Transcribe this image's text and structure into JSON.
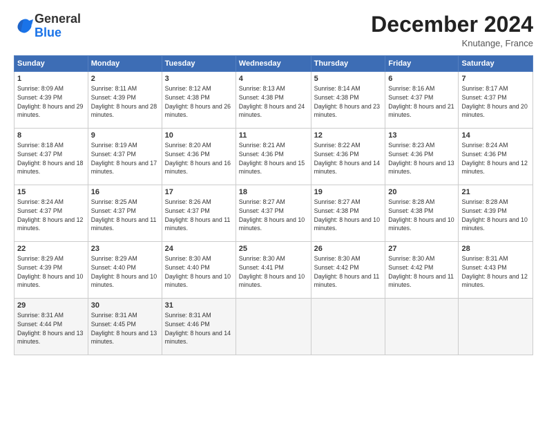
{
  "header": {
    "logo_general": "General",
    "logo_blue": "Blue",
    "title": "December 2024",
    "location": "Knutange, France"
  },
  "days_of_week": [
    "Sunday",
    "Monday",
    "Tuesday",
    "Wednesday",
    "Thursday",
    "Friday",
    "Saturday"
  ],
  "weeks": [
    [
      {
        "day": "1",
        "sunrise": "8:09 AM",
        "sunset": "4:39 PM",
        "daylight": "8 hours and 29 minutes."
      },
      {
        "day": "2",
        "sunrise": "8:11 AM",
        "sunset": "4:39 PM",
        "daylight": "8 hours and 28 minutes."
      },
      {
        "day": "3",
        "sunrise": "8:12 AM",
        "sunset": "4:38 PM",
        "daylight": "8 hours and 26 minutes."
      },
      {
        "day": "4",
        "sunrise": "8:13 AM",
        "sunset": "4:38 PM",
        "daylight": "8 hours and 24 minutes."
      },
      {
        "day": "5",
        "sunrise": "8:14 AM",
        "sunset": "4:38 PM",
        "daylight": "8 hours and 23 minutes."
      },
      {
        "day": "6",
        "sunrise": "8:16 AM",
        "sunset": "4:37 PM",
        "daylight": "8 hours and 21 minutes."
      },
      {
        "day": "7",
        "sunrise": "8:17 AM",
        "sunset": "4:37 PM",
        "daylight": "8 hours and 20 minutes."
      }
    ],
    [
      {
        "day": "8",
        "sunrise": "8:18 AM",
        "sunset": "4:37 PM",
        "daylight": "8 hours and 18 minutes."
      },
      {
        "day": "9",
        "sunrise": "8:19 AM",
        "sunset": "4:37 PM",
        "daylight": "8 hours and 17 minutes."
      },
      {
        "day": "10",
        "sunrise": "8:20 AM",
        "sunset": "4:36 PM",
        "daylight": "8 hours and 16 minutes."
      },
      {
        "day": "11",
        "sunrise": "8:21 AM",
        "sunset": "4:36 PM",
        "daylight": "8 hours and 15 minutes."
      },
      {
        "day": "12",
        "sunrise": "8:22 AM",
        "sunset": "4:36 PM",
        "daylight": "8 hours and 14 minutes."
      },
      {
        "day": "13",
        "sunrise": "8:23 AM",
        "sunset": "4:36 PM",
        "daylight": "8 hours and 13 minutes."
      },
      {
        "day": "14",
        "sunrise": "8:24 AM",
        "sunset": "4:36 PM",
        "daylight": "8 hours and 12 minutes."
      }
    ],
    [
      {
        "day": "15",
        "sunrise": "8:24 AM",
        "sunset": "4:37 PM",
        "daylight": "8 hours and 12 minutes."
      },
      {
        "day": "16",
        "sunrise": "8:25 AM",
        "sunset": "4:37 PM",
        "daylight": "8 hours and 11 minutes."
      },
      {
        "day": "17",
        "sunrise": "8:26 AM",
        "sunset": "4:37 PM",
        "daylight": "8 hours and 11 minutes."
      },
      {
        "day": "18",
        "sunrise": "8:27 AM",
        "sunset": "4:37 PM",
        "daylight": "8 hours and 10 minutes."
      },
      {
        "day": "19",
        "sunrise": "8:27 AM",
        "sunset": "4:38 PM",
        "daylight": "8 hours and 10 minutes."
      },
      {
        "day": "20",
        "sunrise": "8:28 AM",
        "sunset": "4:38 PM",
        "daylight": "8 hours and 10 minutes."
      },
      {
        "day": "21",
        "sunrise": "8:28 AM",
        "sunset": "4:39 PM",
        "daylight": "8 hours and 10 minutes."
      }
    ],
    [
      {
        "day": "22",
        "sunrise": "8:29 AM",
        "sunset": "4:39 PM",
        "daylight": "8 hours and 10 minutes."
      },
      {
        "day": "23",
        "sunrise": "8:29 AM",
        "sunset": "4:40 PM",
        "daylight": "8 hours and 10 minutes."
      },
      {
        "day": "24",
        "sunrise": "8:30 AM",
        "sunset": "4:40 PM",
        "daylight": "8 hours and 10 minutes."
      },
      {
        "day": "25",
        "sunrise": "8:30 AM",
        "sunset": "4:41 PM",
        "daylight": "8 hours and 10 minutes."
      },
      {
        "day": "26",
        "sunrise": "8:30 AM",
        "sunset": "4:42 PM",
        "daylight": "8 hours and 11 minutes."
      },
      {
        "day": "27",
        "sunrise": "8:30 AM",
        "sunset": "4:42 PM",
        "daylight": "8 hours and 11 minutes."
      },
      {
        "day": "28",
        "sunrise": "8:31 AM",
        "sunset": "4:43 PM",
        "daylight": "8 hours and 12 minutes."
      }
    ],
    [
      {
        "day": "29",
        "sunrise": "8:31 AM",
        "sunset": "4:44 PM",
        "daylight": "8 hours and 13 minutes."
      },
      {
        "day": "30",
        "sunrise": "8:31 AM",
        "sunset": "4:45 PM",
        "daylight": "8 hours and 13 minutes."
      },
      {
        "day": "31",
        "sunrise": "8:31 AM",
        "sunset": "4:46 PM",
        "daylight": "8 hours and 14 minutes."
      },
      null,
      null,
      null,
      null
    ]
  ]
}
